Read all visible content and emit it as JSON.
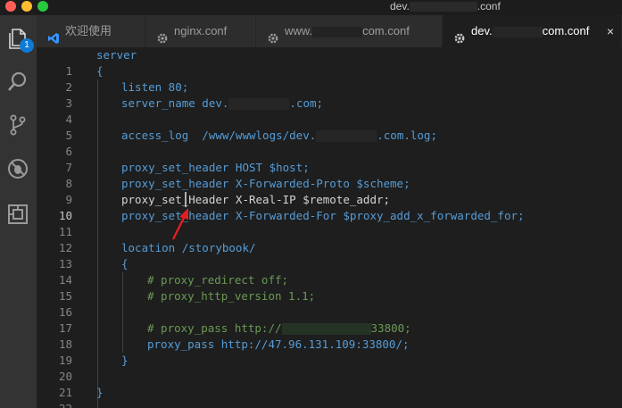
{
  "window": {
    "title_prefix": "dev.",
    "title_suffix": ".conf"
  },
  "activity_bar": {
    "icons": [
      "files-icon",
      "search-icon",
      "source-control-icon",
      "debug-icon",
      "extensions-icon"
    ],
    "badge_count": "1"
  },
  "tabs": [
    {
      "label": "欢迎使用",
      "icon": "vscode-logo-icon",
      "active": false
    },
    {
      "label": "nginx.conf",
      "icon": "gear-icon",
      "active": false
    },
    {
      "label_prefix": "www.",
      "label_suffix": "com.conf",
      "icon": "gear-icon",
      "active": false
    },
    {
      "label_prefix": "dev.",
      "label_suffix": "com.conf",
      "icon": "gear-icon",
      "active": true,
      "close": "×"
    }
  ],
  "editor": {
    "current_line": 10,
    "lines": [
      {
        "n": "1",
        "t": "server"
      },
      {
        "n": "2",
        "t": "{"
      },
      {
        "n": "3",
        "t": "listen 80;"
      },
      {
        "n": "4",
        "t": "server_name dev.",
        "t2": ".com;"
      },
      {
        "n": "5",
        "t": ""
      },
      {
        "n": "6",
        "t": "access_log  /www/wwwlogs/dev.",
        "t2": ".com.log;"
      },
      {
        "n": "7",
        "t": ""
      },
      {
        "n": "8",
        "t": "proxy_set_header HOST $host;"
      },
      {
        "n": "9",
        "t": "proxy_set_header X-Forwarded-Proto $scheme;"
      },
      {
        "n": "10",
        "t": "proxy_set_Header X-Real-IP $remote_addr;"
      },
      {
        "n": "11",
        "t": "proxy_set_header X-Forwarded-For $proxy_add_x_forwarded_for;"
      },
      {
        "n": "12",
        "t": ""
      },
      {
        "n": "13",
        "t": "location /storybook/"
      },
      {
        "n": "14",
        "t": "{"
      },
      {
        "n": "15",
        "t": "# proxy_redirect off;"
      },
      {
        "n": "16",
        "t": "# proxy_http_version 1.1;"
      },
      {
        "n": "17",
        "t": ""
      },
      {
        "n": "18",
        "t": "# proxy_pass http://",
        "t2": "33800;"
      },
      {
        "n": "19",
        "t": "proxy_pass http://47.96.131.109:33800/;"
      },
      {
        "n": "20",
        "t": "}"
      },
      {
        "n": "21",
        "t": ""
      },
      {
        "n": "22",
        "t": "}"
      }
    ]
  },
  "colors": {
    "keyword": "#569cd6",
    "comment": "#6a9955",
    "annotation_arrow": "#e02020"
  }
}
